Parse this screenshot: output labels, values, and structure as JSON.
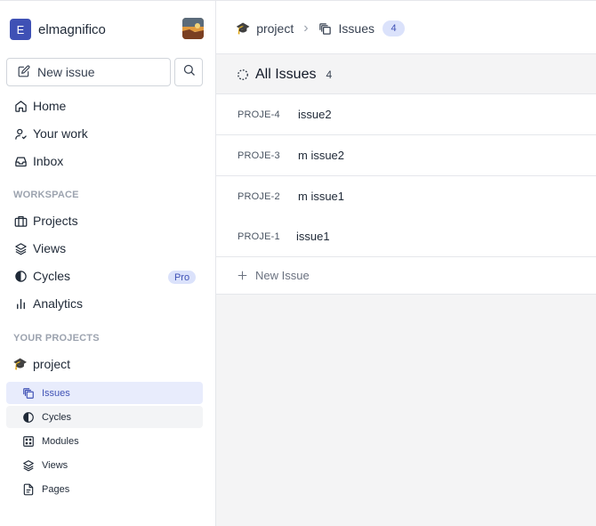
{
  "workspace": {
    "initial": "E",
    "name": "elmagnifico"
  },
  "sidebar": {
    "new_issue_label": "New issue",
    "nav": [
      {
        "label": "Home",
        "icon": "home-icon"
      },
      {
        "label": "Your work",
        "icon": "user-icon"
      },
      {
        "label": "Inbox",
        "icon": "inbox-icon"
      }
    ],
    "workspace_label": "WORKSPACE",
    "workspace_items": [
      {
        "label": "Projects",
        "icon": "briefcase-icon"
      },
      {
        "label": "Views",
        "icon": "layers-icon"
      },
      {
        "label": "Cycles",
        "icon": "contrast-icon",
        "badge": "Pro"
      },
      {
        "label": "Analytics",
        "icon": "bar-chart-icon"
      }
    ],
    "projects_label": "YOUR PROJECTS",
    "project": {
      "name": "project",
      "emoji": "🎓"
    },
    "project_items": [
      {
        "label": "Issues",
        "icon": "layers-stack-icon",
        "active": true
      },
      {
        "label": "Cycles",
        "icon": "contrast-icon"
      },
      {
        "label": "Modules",
        "icon": "grid-icon"
      },
      {
        "label": "Views",
        "icon": "layers-icon"
      },
      {
        "label": "Pages",
        "icon": "file-text-icon"
      }
    ]
  },
  "breadcrumb": {
    "project_emoji": "🎓",
    "project": "project",
    "separator": "›",
    "current": "Issues",
    "count": "4"
  },
  "list": {
    "title": "All Issues",
    "count": "4",
    "rows": [
      {
        "id": "PROJE-4",
        "title": "issue2"
      },
      {
        "id": "PROJE-3",
        "title": "m issue2"
      },
      {
        "id": "PROJE-2",
        "title": "m issue1"
      },
      {
        "id": "PROJE-1",
        "title": "issue1"
      }
    ],
    "new_issue_label": "New Issue"
  },
  "colors": {
    "accent": "#3f51b5",
    "accent_soft": "#dbe2fb",
    "border": "#e5e7eb",
    "muted": "#9ca3af"
  }
}
